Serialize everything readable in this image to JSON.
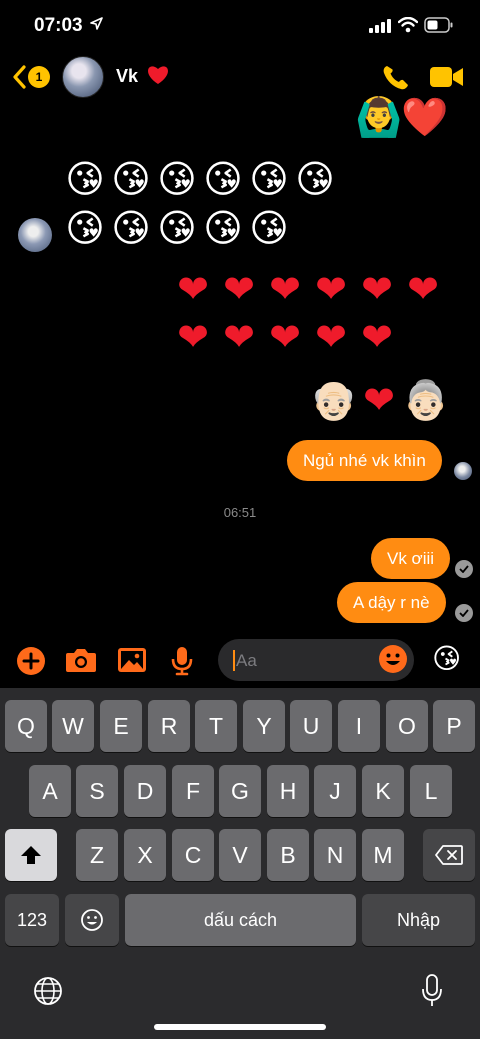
{
  "status_bar": {
    "time": "07:03"
  },
  "header": {
    "back_badge": "1",
    "contact_name": "Vk"
  },
  "chat": {
    "top_emojis": [
      "🙆‍♂️",
      "❤️"
    ],
    "kiss_row_1": [
      "😘",
      "😘",
      "😘",
      "😘",
      "😘",
      "😘"
    ],
    "kiss_row_2": [
      "😘",
      "😘",
      "😘",
      "😘",
      "😘"
    ],
    "heart_row_1": [
      "❤",
      "❤",
      "❤",
      "❤",
      "❤",
      "❤"
    ],
    "heart_row_2": [
      "❤",
      "❤",
      "❤",
      "❤",
      "❤"
    ],
    "elder_row": [
      "👴🏻",
      "❤",
      "👵🏻"
    ],
    "bubble_1": "Ngủ nhé vk khìn",
    "timestamp": "06:51",
    "bubble_2": "Vk ơiii",
    "bubble_3": "A dậy r nè"
  },
  "composer": {
    "placeholder": "Aa",
    "quick_reaction": "😘"
  },
  "keyboard": {
    "row1": [
      "Q",
      "W",
      "E",
      "R",
      "T",
      "Y",
      "U",
      "I",
      "O",
      "P"
    ],
    "row2": [
      "A",
      "S",
      "D",
      "F",
      "G",
      "H",
      "J",
      "K",
      "L"
    ],
    "row3": [
      "Z",
      "X",
      "C",
      "V",
      "B",
      "N",
      "M"
    ],
    "numbers_key": "123",
    "space_key": "dấu cách",
    "return_key": "Nhập"
  },
  "colors": {
    "accent": "#ff8c12",
    "header_yellow": "#ffc300",
    "heart_red": "#ef1b2b",
    "keyboard_bg": "#2b2b2d"
  }
}
